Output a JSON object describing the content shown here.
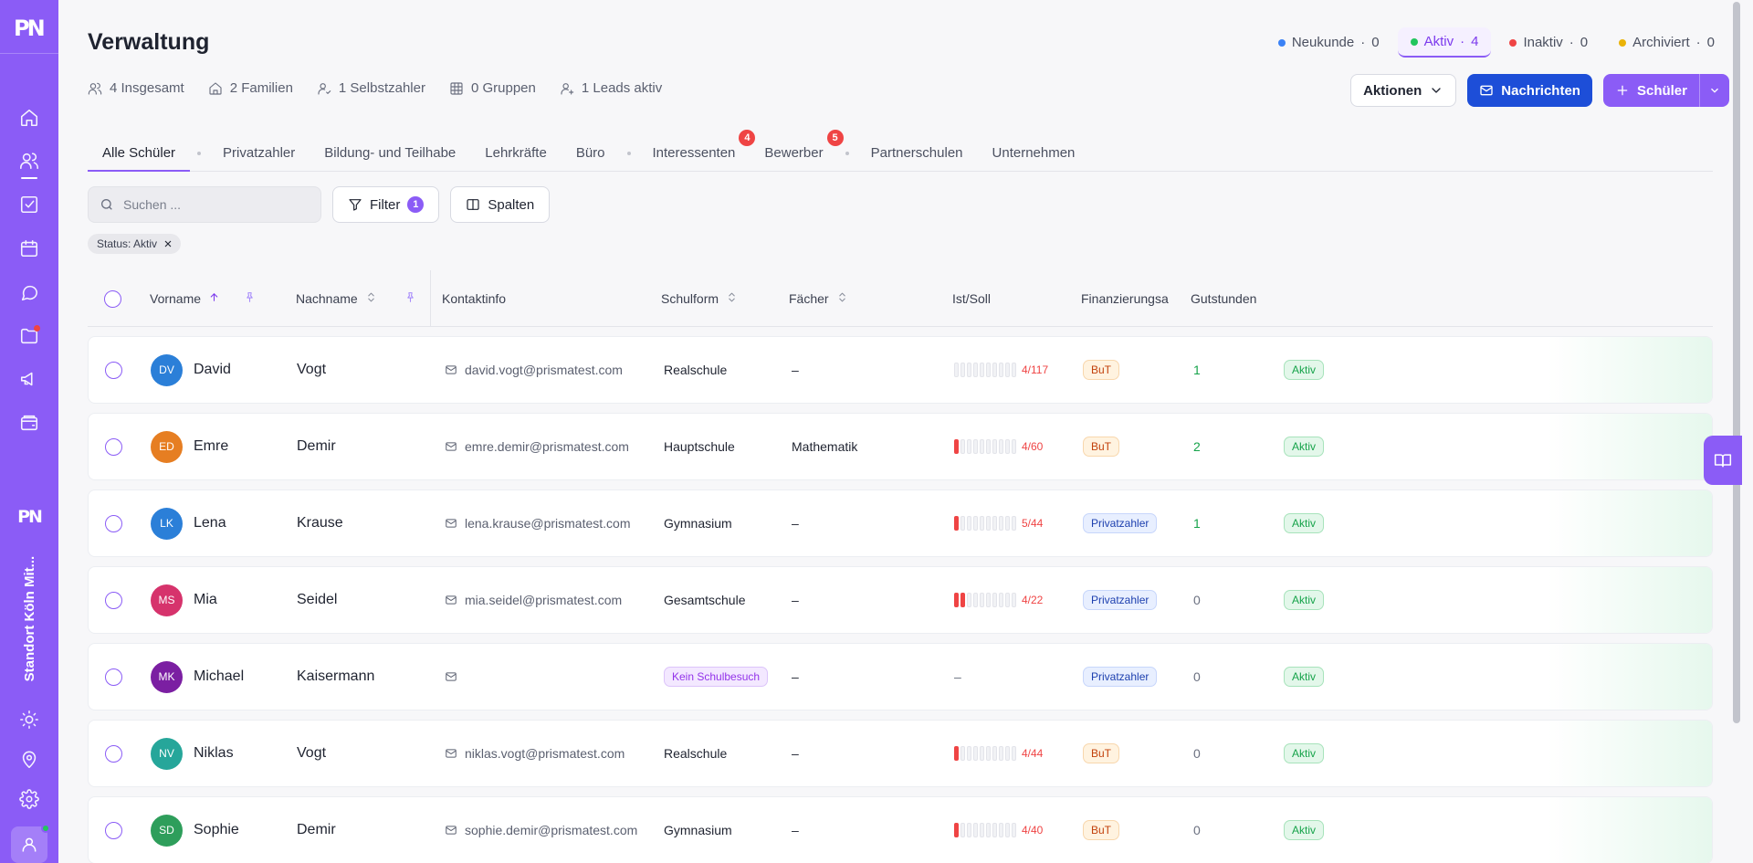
{
  "sidebar": {
    "logo": "PN",
    "logo_small": "PN",
    "location": "Standort Köln Mit...",
    "accent": "#8b5cf6"
  },
  "header": {
    "title": "Verwaltung",
    "stats": [
      {
        "icon": "users-icon",
        "label": "4 Insgesamt"
      },
      {
        "icon": "house-icon",
        "label": "2 Familien"
      },
      {
        "icon": "user-check-icon",
        "label": "1 Selbstzahler"
      },
      {
        "icon": "grid-icon",
        "label": "0 Gruppen"
      },
      {
        "icon": "user-plus-icon",
        "label": "1 Leads aktiv"
      }
    ],
    "status_tabs": [
      {
        "label": "Neukunde",
        "sep": "·",
        "count": "0",
        "color": "#3b82f6"
      },
      {
        "label": "Aktiv",
        "sep": "·",
        "count": "4",
        "color": "#22c55e"
      },
      {
        "label": "Inaktiv",
        "sep": "·",
        "count": "0",
        "color": "#ef4444"
      },
      {
        "label": "Archiviert",
        "sep": "·",
        "count": "0",
        "color": "#eab308"
      }
    ],
    "actions_label": "Aktionen",
    "messages_label": "Nachrichten",
    "add_student_label": "Schüler"
  },
  "tabs": [
    {
      "label": "Alle Schüler"
    },
    {
      "label": "Privatzahler"
    },
    {
      "label": "Bildung- und Teilhabe"
    },
    {
      "label": "Lehrkräfte"
    },
    {
      "label": "Büro"
    },
    {
      "label": "Interessenten",
      "badge": "4"
    },
    {
      "label": "Bewerber",
      "badge": "5"
    },
    {
      "label": "Partnerschulen"
    },
    {
      "label": "Unternehmen"
    }
  ],
  "toolbar": {
    "search_placeholder": "Suchen ...",
    "filter_label": "Filter",
    "filter_count": "1",
    "columns_label": "Spalten"
  },
  "active_filter": "Status: Aktiv",
  "table": {
    "columns": {
      "first": "Vorname",
      "last": "Nachname",
      "contact": "Kontaktinfo",
      "school": "Schulform",
      "subjects": "Fächer",
      "ist_soll": "Ist/Soll",
      "financing": "Finanzierungsart",
      "credit": "Gutstunden"
    },
    "rows": [
      {
        "initials": "DV",
        "avatar_color": "#2b7fd8",
        "first": "David",
        "last": "Vogt",
        "email": "david.vogt@prismatest.com",
        "school": "Realschule",
        "subjects": "–",
        "filled": 0,
        "ratio": "4/117",
        "financing": "BuT",
        "credit": "1",
        "status": "Aktiv"
      },
      {
        "initials": "ED",
        "avatar_color": "#e67e22",
        "first": "Emre",
        "last": "Demir",
        "email": "emre.demir@prismatest.com",
        "school": "Hauptschule",
        "subjects": "Mathematik",
        "filled": 1,
        "ratio": "4/60",
        "financing": "BuT",
        "credit": "2",
        "status": "Aktiv"
      },
      {
        "initials": "LK",
        "avatar_color": "#2b7fd8",
        "first": "Lena",
        "last": "Krause",
        "email": "lena.krause@prismatest.com",
        "school": "Gymnasium",
        "subjects": "–",
        "filled": 1,
        "ratio": "5/44",
        "financing": "Privatzahler",
        "credit": "1",
        "status": "Aktiv"
      },
      {
        "initials": "MS",
        "avatar_color": "#d6336c",
        "first": "Mia",
        "last": "Seidel",
        "email": "mia.seidel@prismatest.com",
        "school": "Gesamtschule",
        "subjects": "–",
        "filled": 2,
        "ratio": "4/22",
        "financing": "Privatzahler",
        "credit": "0",
        "status": "Aktiv"
      },
      {
        "initials": "MK",
        "avatar_color": "#7b1fa2",
        "first": "Michael",
        "last": "Kaisermann",
        "email": "",
        "school": "Kein Schulbesuch",
        "subjects": "–",
        "filled": null,
        "ratio": "–",
        "financing": "Privatzahler",
        "credit": "0",
        "status": "Aktiv"
      },
      {
        "initials": "NV",
        "avatar_color": "#26a69a",
        "first": "Niklas",
        "last": "Vogt",
        "email": "niklas.vogt@prismatest.com",
        "school": "Realschule",
        "subjects": "–",
        "filled": 1,
        "ratio": "4/44",
        "financing": "BuT",
        "credit": "0",
        "status": "Aktiv"
      },
      {
        "initials": "SD",
        "avatar_color": "#2e9e5b",
        "first": "Sophie",
        "last": "Demir",
        "email": "sophie.demir@prismatest.com",
        "school": "Gymnasium",
        "subjects": "–",
        "filled": 1,
        "ratio": "4/40",
        "financing": "BuT",
        "credit": "0",
        "status": "Aktiv"
      }
    ]
  }
}
